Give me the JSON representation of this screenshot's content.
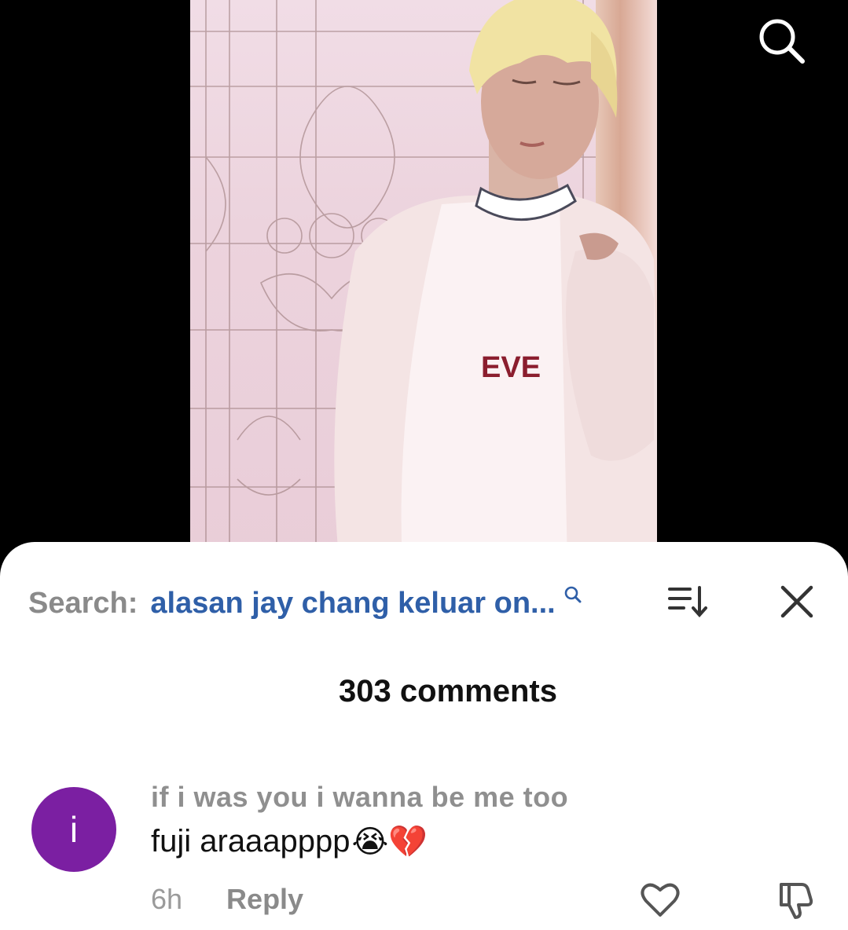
{
  "video": {
    "description_icon": "video-thumbnail"
  },
  "top_search": {
    "icon": "search-icon"
  },
  "search_bar": {
    "label": "Search:",
    "query": "alasan jay chang keluar on...",
    "icon": "search-icon"
  },
  "toolbar": {
    "sort_icon": "sort-icon",
    "close_icon": "close-icon"
  },
  "comments": {
    "count_label": "303 comments",
    "items": [
      {
        "avatar_letter": "i",
        "avatar_color": "#7b1fa2",
        "username": "if i was you i wanna be me too",
        "text": "fuji araaapppp",
        "emojis": "😭💔",
        "time": "6h",
        "reply_label": "Reply",
        "like_icon": "heart-icon",
        "dislike_icon": "thumbs-down-icon"
      }
    ]
  },
  "colors": {
    "accent_link": "#2f5fa8",
    "muted_text": "#8a8a8a",
    "background": "#000000",
    "sheet": "#ffffff"
  }
}
